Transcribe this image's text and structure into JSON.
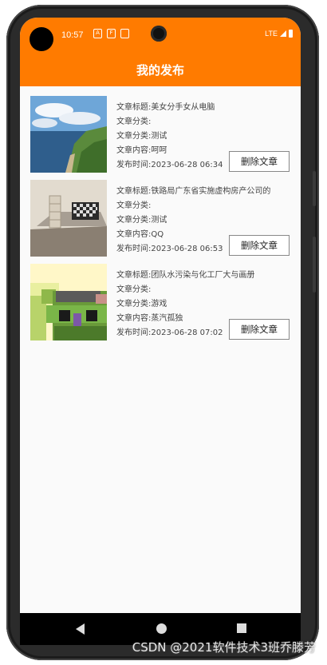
{
  "status_bar": {
    "time": "10:57",
    "network": "LTE"
  },
  "toolbar": {
    "title": "我的发布"
  },
  "articles": [
    {
      "title": "文章标题:美女分手女从电脑",
      "category1": "文章分类:",
      "category2": "文章分类:测试",
      "content": "文章内容:呵呵",
      "time": "发布时间:2023-06-28 06:34",
      "delete_label": "删除文章",
      "image": "coastal-landscape"
    },
    {
      "title": "文章标题:铁路局广东省实施虚构房产公司的",
      "category1": "文章分类:",
      "category2": "文章分类:测试",
      "content": "文章内容:QQ",
      "time": "发布时间:2023-06-28 06:53",
      "delete_label": "删除文章",
      "image": "room-interior"
    },
    {
      "title": "文章标题:团队水污染与化工厂大与画册",
      "category1": "文章分类:",
      "category2": "文章分类:游戏",
      "content": "文章内容:蒸汽孤独",
      "time": "发布时间:2023-06-28 07:02",
      "delete_label": "删除文章",
      "image": "pixel-character"
    }
  ],
  "watermark": "CSDN @2021软件技术3班乔滕芳"
}
